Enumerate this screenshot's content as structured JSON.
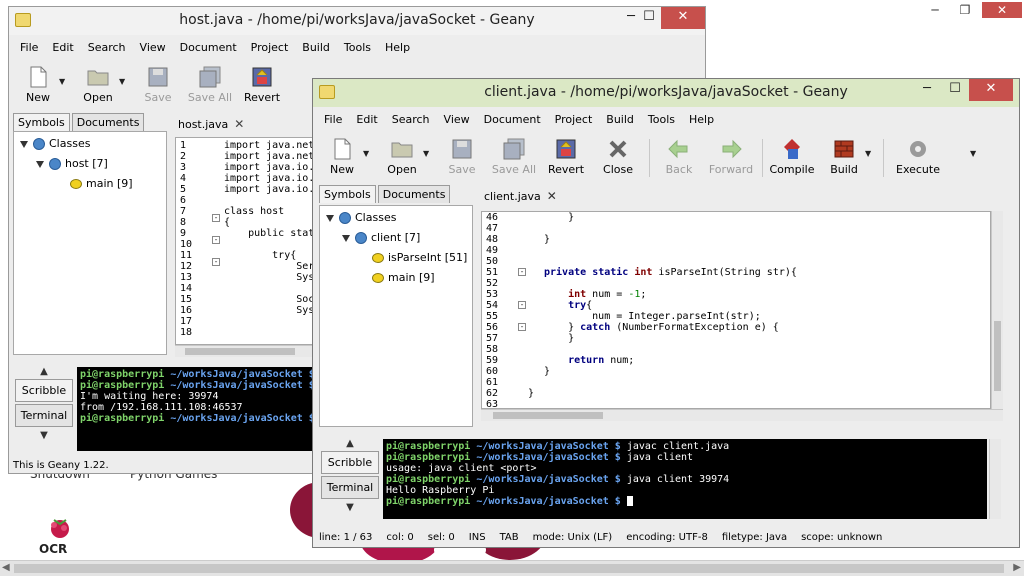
{
  "background": {
    "text_left": "Shutdown",
    "text_right": "Python Games",
    "logo_text": "OCR"
  },
  "host_window": {
    "title": "host.java - /home/pi/worksJava/javaSocket - Geany",
    "menu": [
      "File",
      "Edit",
      "Search",
      "View",
      "Document",
      "Project",
      "Build",
      "Tools",
      "Help"
    ],
    "toolbar": [
      {
        "label": "New",
        "enabled": true
      },
      {
        "label": "Open",
        "enabled": true
      },
      {
        "label": "Save",
        "enabled": false
      },
      {
        "label": "Save All",
        "enabled": false
      },
      {
        "label": "Revert",
        "enabled": true
      }
    ],
    "sidebar_tabs": [
      "Symbols",
      "Documents"
    ],
    "tree": {
      "classes": "Classes",
      "cls": "host [7]",
      "method": "main [9]"
    },
    "editor_tab": "host.java",
    "line_numbers": [
      "1",
      "2",
      "3",
      "4",
      "5",
      "6",
      "7",
      "8",
      "9",
      "10",
      "11",
      "12",
      "13",
      "14",
      "15",
      "16",
      "17",
      "18"
    ],
    "code": [
      "import java.net",
      "import java.net",
      "import java.io.",
      "import java.io.",
      "import java.io.",
      "",
      "class host",
      "{",
      "    public stat",
      "",
      "        try{",
      "            Ser",
      "            Sys",
      "",
      "            Soc",
      "            Sys",
      "",
      ""
    ],
    "msg_tabs": [
      "Scribble",
      "Terminal"
    ],
    "terminal": [
      {
        "user": "pi@raspberrypi",
        "path": " ~/worksJava/javaSocket $",
        "cmd": ""
      },
      {
        "user": "pi@raspberrypi",
        "path": " ~/worksJava/javaSocket $",
        "cmd": ""
      },
      {
        "text": "I'm waiting here: 39974"
      },
      {
        "text": "from /192.168.111.108:46537"
      },
      {
        "user": "pi@raspberrypi",
        "path": " ~/worksJava/javaSocket $",
        "cmd": ""
      }
    ],
    "status": "This is Geany 1.22."
  },
  "client_window": {
    "title": "client.java - /home/pi/worksJava/javaSocket - Geany",
    "menu": [
      "File",
      "Edit",
      "Search",
      "View",
      "Document",
      "Project",
      "Build",
      "Tools",
      "Help"
    ],
    "toolbar": [
      {
        "label": "New",
        "enabled": true
      },
      {
        "label": "Open",
        "enabled": true
      },
      {
        "label": "Save",
        "enabled": false
      },
      {
        "label": "Save All",
        "enabled": false
      },
      {
        "label": "Revert",
        "enabled": true
      },
      {
        "label": "Close",
        "enabled": true
      },
      {
        "label": "Back",
        "enabled": false
      },
      {
        "label": "Forward",
        "enabled": false
      },
      {
        "label": "Compile",
        "enabled": true
      },
      {
        "label": "Build",
        "enabled": true
      },
      {
        "label": "Execute",
        "enabled": true
      }
    ],
    "sidebar_tabs": [
      "Symbols",
      "Documents"
    ],
    "tree": {
      "classes": "Classes",
      "cls": "client [7]",
      "method1": "isParseInt [51]",
      "method2": "main [9]"
    },
    "editor_tab": "client.java",
    "line_numbers": [
      "46",
      "47",
      "48",
      "49",
      "50",
      "51",
      "52",
      "53",
      "54",
      "55",
      "56",
      "57",
      "58",
      "59",
      "60",
      "61",
      "62",
      "63"
    ],
    "msg_tabs": [
      "Scribble",
      "Terminal"
    ],
    "terminal": [
      {
        "user": "pi@raspberrypi",
        "path": " ~/worksJava/javaSocket $",
        "cmd": " javac client.java"
      },
      {
        "user": "pi@raspberrypi",
        "path": " ~/worksJava/javaSocket $",
        "cmd": " java client"
      },
      {
        "text": "usage: java client <port>"
      },
      {
        "user": "pi@raspberrypi",
        "path": " ~/worksJava/javaSocket $",
        "cmd": " java client 39974"
      },
      {
        "text": "Hello Raspberry Pi"
      },
      {
        "user": "pi@raspberrypi",
        "path": " ~/worksJava/javaSocket $",
        "cmd": " "
      }
    ],
    "status": {
      "line": "line: 1 / 63",
      "col": "col: 0",
      "sel": "sel: 0",
      "ins": "INS",
      "tab": "TAB",
      "mode": "mode: Unix (LF)",
      "enc": "encoding: UTF-8",
      "filetype": "filetype: Java",
      "scope": "scope: unknown"
    }
  }
}
